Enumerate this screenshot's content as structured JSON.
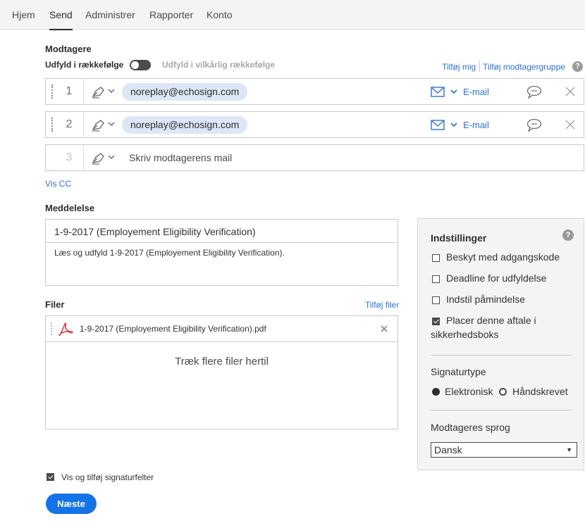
{
  "nav": {
    "tabs": [
      "Hjem",
      "Send",
      "Administrer",
      "Rapporter",
      "Konto"
    ],
    "active": "Send"
  },
  "recipients": {
    "heading": "Modtagere",
    "order_label": "Udfyld i rækkefølge",
    "any_order_label": "Udfyld i vilkårlig rækkefølge",
    "add_me": "Tilføj mig",
    "add_group": "Tilføj modtagergruppe",
    "rows": [
      {
        "number": "1",
        "email": "noreplay@echosign.com",
        "method": "E-mail"
      },
      {
        "number": "2",
        "email": "noreplay@echosign.com",
        "method": "E-mail"
      },
      {
        "number": "3",
        "placeholder": "Skriv modtagerens mail"
      }
    ],
    "show_cc": "Vis CC"
  },
  "message": {
    "heading": "Meddelelse",
    "subject": "1-9-2017 (Employement Eligibility Verification)",
    "body": "Læs og udfyld 1-9-2017 (Employement Eligibility Verification)."
  },
  "files": {
    "heading": "Filer",
    "add_files": "Tilføj filer",
    "items": [
      {
        "name": "1-9-2017 (Employement Eligibility Verification).pdf"
      }
    ],
    "drop_text": "Træk flere filer hertil"
  },
  "settings": {
    "title": "Indstillinger",
    "help": "?",
    "options": [
      {
        "label": "Beskyt med adgangskode",
        "checked": false
      },
      {
        "label": "Deadline for udfyldelse",
        "checked": false
      },
      {
        "label": "Indstil påmindelse",
        "checked": false
      },
      {
        "label_line1": "Placer denne aftale i",
        "label_line2": "sikkerhedsboks",
        "checked": true
      }
    ],
    "signature_type_label": "Signaturtype",
    "signature_types": [
      {
        "label": "Elektronisk",
        "selected": true
      },
      {
        "label": "Håndskrevet",
        "selected": false
      }
    ],
    "language_label": "Modtageres sprog",
    "language_value": "Dansk"
  },
  "footer": {
    "show_fields_label": "Vis og tilføj signaturfelter",
    "show_fields_checked": true,
    "next_label": "Næste"
  },
  "colors": {
    "accent": "#1473e6",
    "link": "#2d72d2",
    "chip": "#dce7f5",
    "pdf_red": "#d7373f"
  }
}
